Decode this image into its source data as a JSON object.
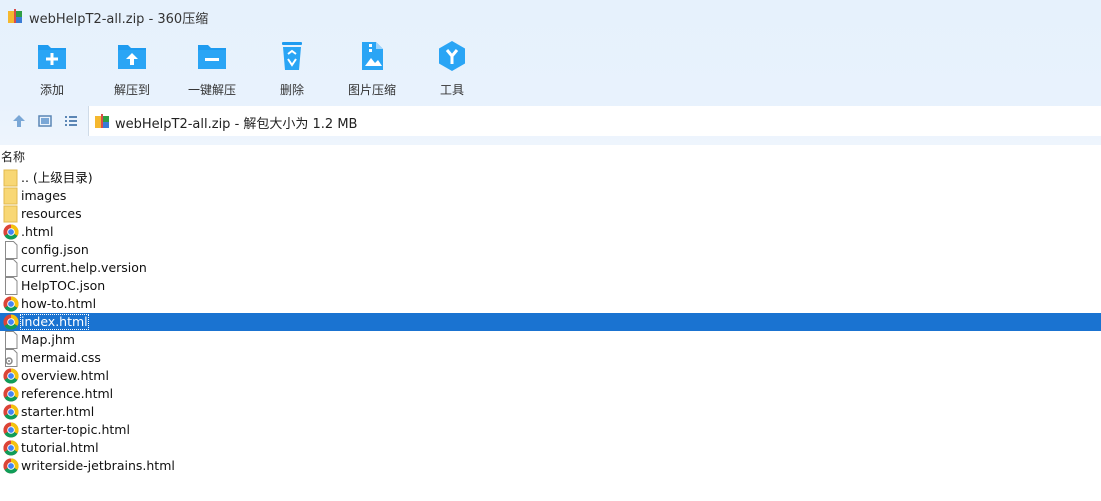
{
  "window": {
    "title": "webHelpT2-all.zip - 360压缩"
  },
  "toolbar": {
    "items": [
      {
        "label": "添加",
        "icon": "add-icon"
      },
      {
        "label": "解压到",
        "icon": "extract-to-icon"
      },
      {
        "label": "一键解压",
        "icon": "one-click-extract-icon"
      },
      {
        "label": "删除",
        "icon": "delete-icon"
      },
      {
        "label": "图片压缩",
        "icon": "image-compress-icon"
      },
      {
        "label": "工具",
        "icon": "tools-icon"
      }
    ]
  },
  "address": {
    "path": "webHelpT2-all.zip - 解包大小为 1.2 MB"
  },
  "columns": {
    "name": "名称"
  },
  "files": [
    {
      "name": ".. (上级目录)",
      "type": "folder"
    },
    {
      "name": "images",
      "type": "folder"
    },
    {
      "name": "resources",
      "type": "folder"
    },
    {
      "name": ".html",
      "type": "chrome"
    },
    {
      "name": "config.json",
      "type": "file"
    },
    {
      "name": "current.help.version",
      "type": "file"
    },
    {
      "name": "HelpTOC.json",
      "type": "file"
    },
    {
      "name": "how-to.html",
      "type": "chrome"
    },
    {
      "name": "index.html",
      "type": "chrome",
      "selected": true
    },
    {
      "name": "Map.jhm",
      "type": "file"
    },
    {
      "name": "mermaid.css",
      "type": "css"
    },
    {
      "name": "overview.html",
      "type": "chrome"
    },
    {
      "name": "reference.html",
      "type": "chrome"
    },
    {
      "name": "starter.html",
      "type": "chrome"
    },
    {
      "name": "starter-topic.html",
      "type": "chrome"
    },
    {
      "name": "tutorial.html",
      "type": "chrome"
    },
    {
      "name": "writerside-jetbrains.html",
      "type": "chrome"
    }
  ],
  "colors": {
    "accent": "#1e9bf0",
    "selection": "#1a73d1",
    "band": "#e6f1fc",
    "folder": "#f8d775"
  }
}
